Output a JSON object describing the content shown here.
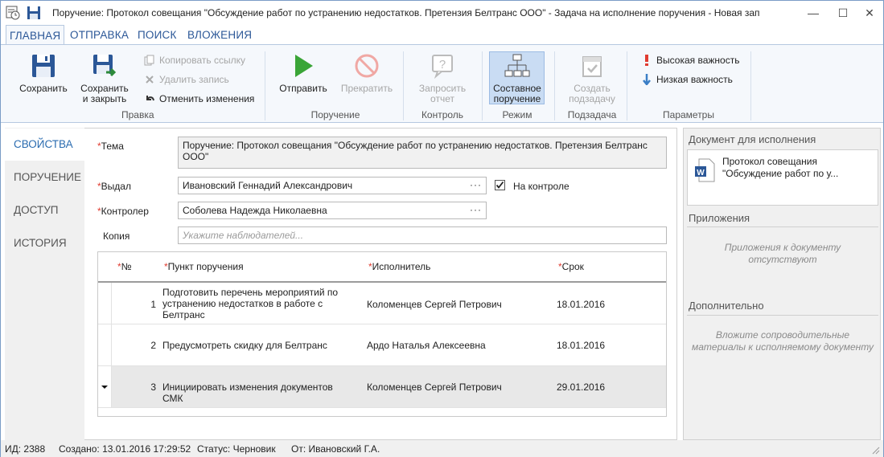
{
  "titlebar": {
    "title": "Поручение: Протокол совещания \"Обсуждение работ по устранению недостатков. Претензия Белтранс ООО\" - Задача на исполнение поручения - Новая запи..."
  },
  "tabs": [
    "ГЛАВНАЯ",
    "ОТПРАВКА",
    "ПОИСК",
    "ВЛОЖЕНИЯ"
  ],
  "ribbon": {
    "save": "Сохранить",
    "save_close_1": "Сохранить",
    "save_close_2": "и закрыть",
    "copy_link": "Копировать ссылку",
    "delete_record": "Удалить запись",
    "undo_changes": "Отменить изменения",
    "send": "Отправить",
    "stop": "Прекратить",
    "request_report_1": "Запросить",
    "request_report_2": "отчет",
    "composite_1": "Составное",
    "composite_2": "поручение",
    "create_subtask_1": "Создать",
    "create_subtask_2": "подзадачу",
    "high_importance": "Высокая важность",
    "low_importance": "Низкая важность",
    "groups": {
      "edit": "Правка",
      "order": "Поручение",
      "control": "Контроль",
      "mode": "Режим",
      "subtask": "Подзадача",
      "params": "Параметры"
    }
  },
  "sidebar": [
    "СВОЙСТВА",
    "ПОРУЧЕНИЕ",
    "ДОСТУП",
    "ИСТОРИЯ"
  ],
  "form": {
    "subject_label": "Тема",
    "subject_value": "Поручение: Протокол совещания \"Обсуждение работ по устранению недостатков. Претензия Белтранс ООО\"",
    "issued_label": "Выдал",
    "issued_value": "Ивановский Геннадий Александрович",
    "on_control_label": "На контроле",
    "on_control_checked": true,
    "controller_label": "Контролер",
    "controller_value": "Соболева Надежда Николаевна",
    "copy_label": "Копия",
    "copy_placeholder": "Укажите наблюдателей...",
    "dots": "···"
  },
  "grid": {
    "headers": [
      "№",
      "Пункт поручения",
      "Исполнитель",
      "Срок"
    ],
    "rows": [
      {
        "num": "1",
        "item": "Подготовить перечень мероприятий по устранению недостатков в работе с Белтранс",
        "executor": "Коломенцев Сергей Петрович",
        "due": "18.01.2016"
      },
      {
        "num": "2",
        "item": "Предусмотреть скидку для Белтранс",
        "executor": "Ардо Наталья Алексеевна",
        "due": "18.01.2016"
      },
      {
        "num": "3",
        "item": "Инициировать изменения документов СМК",
        "executor": "Коломенцев Сергей Петрович",
        "due": "29.01.2016"
      }
    ]
  },
  "right": {
    "doc_header": "Документ для исполнения",
    "doc_name_1": "Протокол совещания",
    "doc_name_2": "\"Обсуждение работ по у...",
    "attachments_header": "Приложения",
    "attachments_empty_1": "Приложения к документу",
    "attachments_empty_2": "отсутствуют",
    "extra_header": "Дополнительно",
    "extra_hint_1": "Вложите сопроводительные",
    "extra_hint_2": "материалы к исполняемому документу"
  },
  "status": {
    "id": "ИД: 2388",
    "created": "Создано: 13.01.2016 17:29:52",
    "state": "Статус: Черновик",
    "from": "От: Ивановский Г.А."
  },
  "colors": {
    "accent": "#2b6cb0",
    "required": "#e03c31",
    "ribbon_bg": "#f5f8fc"
  }
}
